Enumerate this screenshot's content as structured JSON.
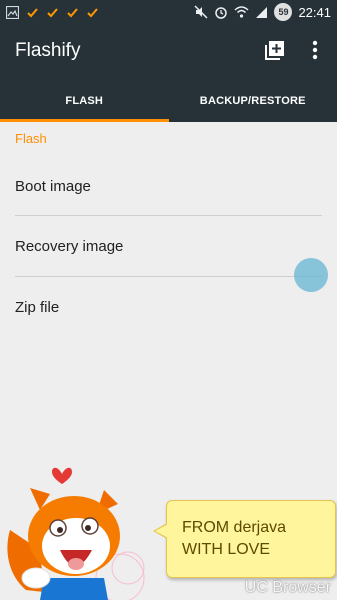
{
  "status_bar": {
    "time": "22:41",
    "battery_level": "59",
    "left_icons": [
      "image-icon",
      "check-icon",
      "check-icon",
      "check-icon",
      "check-icon"
    ],
    "right_icons": [
      "mute-icon",
      "alarm-icon",
      "wifi-icon",
      "signal-icon"
    ]
  },
  "app_bar": {
    "title": "Flashify",
    "actions": [
      "add-queue-icon",
      "overflow-menu-icon"
    ]
  },
  "tabs": [
    {
      "label": "FLASH",
      "active": true
    },
    {
      "label": "BACKUP/RESTORE",
      "active": false
    }
  ],
  "flash_section": {
    "header": "Flash",
    "items": [
      {
        "label": "Boot image"
      },
      {
        "label": "Recovery image"
      },
      {
        "label": "Zip file"
      }
    ]
  },
  "overlay": {
    "bubble_line1": "FROM derjava",
    "bubble_line2": "WITH LOVE",
    "watermark": "UC Browser"
  },
  "colors": {
    "toolbar": "#263238",
    "accent": "#ff8f00",
    "background": "#eeeeee"
  }
}
